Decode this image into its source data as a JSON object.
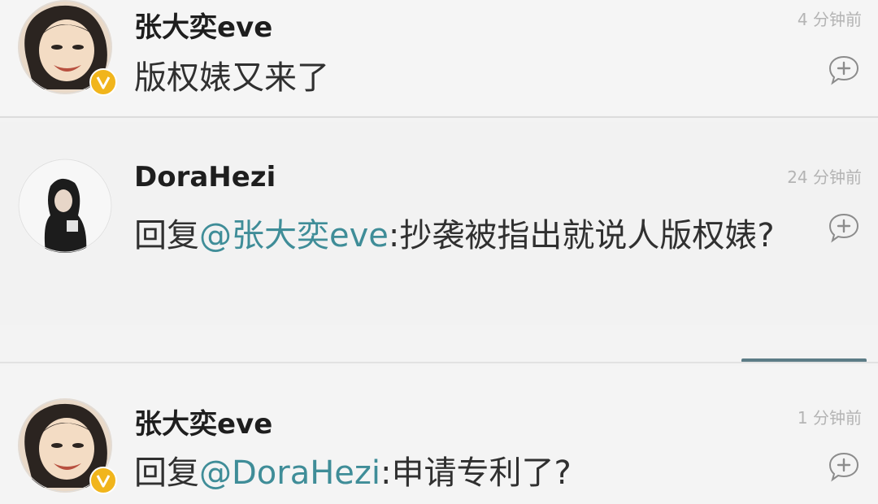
{
  "comments": [
    {
      "user": "张大奕eve",
      "time": "4 分钟前",
      "text": "版权婊又来了",
      "verified": true
    },
    {
      "user": "DoraHezi",
      "time": "24 分钟前",
      "reply_prefix": "回复",
      "mention": "@张大奕eve",
      "text": ":抄袭被指出就说人版权婊?",
      "verified": false
    },
    {
      "user": "张大奕eve",
      "time": "1 分钟前",
      "reply_prefix": "回复",
      "mention": "@DoraHezi",
      "text": ":申请专利了?",
      "verified": true
    }
  ],
  "icons": {
    "reply": "comment-plus-icon",
    "verified": "verified-v-badge-icon"
  },
  "colors": {
    "mention": "#3f8d98",
    "verified_badge": "#f1b51c",
    "accent_line": "#5c7c86"
  }
}
